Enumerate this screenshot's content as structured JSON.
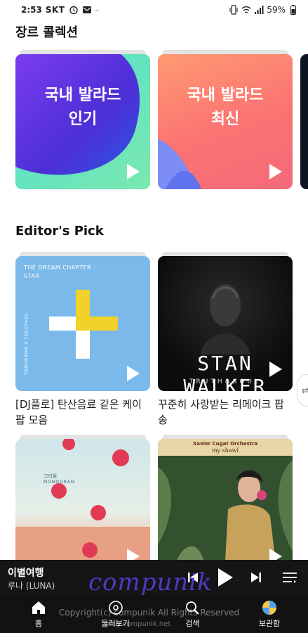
{
  "status_bar": {
    "time": "2:53",
    "carrier": "SKT",
    "battery": "59%",
    "icons": [
      "alarm-icon",
      "mail-icon",
      "vibrate-icon",
      "wifi-icon",
      "signal-icon",
      "battery-icon"
    ]
  },
  "genre_section": {
    "title": "장르 콜렉션",
    "cards": [
      {
        "title_line1": "국내 발라드",
        "title_line2": "인기",
        "colors": [
          "#6f5cf0",
          "#4fd3c8",
          "#7ae0a6"
        ]
      },
      {
        "title_line1": "국내 발라드",
        "title_line2": "최신",
        "colors": [
          "#ff8a6d",
          "#fa6b6b",
          "#7b8cf6"
        ]
      }
    ]
  },
  "editors_section": {
    "title": "Editor's Pick",
    "cards": [
      {
        "caption": "[DJ플로] 탄산음료 같은 케이팝 모음",
        "cover_top": "THE DREAM CHAPTER :",
        "cover_sub": "STAR",
        "cover_side": "TOMORROW X TOGETHER"
      },
      {
        "caption": "꾸준히 사랑받는 리메이크 팝송",
        "cover_main": "STAN WALKER",
        "cover_sub": "TRUTH&SOUL"
      },
      {
        "cover_label_line1": "그리움",
        "cover_label_line2": "MONOGRAM"
      },
      {
        "cover_band": "Xavier Cugat Orchestra",
        "cover_song": "my shawl"
      }
    ]
  },
  "mini_player": {
    "title": "이별여행",
    "artist": "루나 (LUNA)"
  },
  "bottom_nav": {
    "items": [
      {
        "label": "홈",
        "icon": "home-icon"
      },
      {
        "label": "둘러보기",
        "icon": "explore-icon"
      },
      {
        "label": "검색",
        "icon": "search-icon"
      },
      {
        "label": "보관함",
        "icon": "library-icon"
      }
    ]
  },
  "watermark": {
    "logo": "compunik",
    "copyright": "Copyright(c) compunik All Rights Reserved",
    "url": "blog.compunik.net"
  }
}
